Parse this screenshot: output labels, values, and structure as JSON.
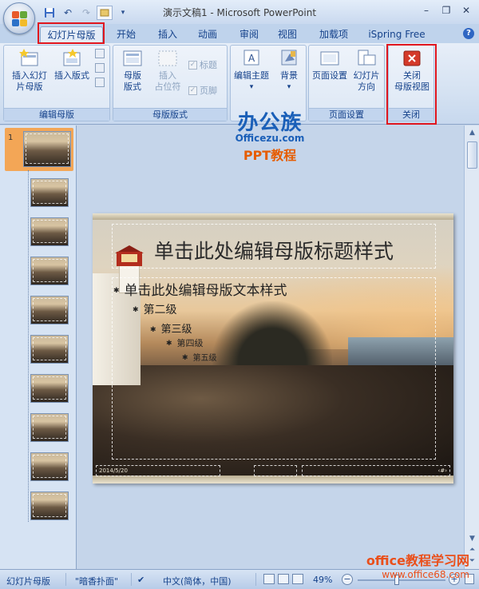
{
  "window": {
    "title": "演示文稿1 - Microsoft PowerPoint",
    "controls": [
      "–",
      "❐",
      "✕"
    ]
  },
  "qat": {
    "icons": [
      "save-icon",
      "undo-icon",
      "redo-icon",
      "customize-icon"
    ]
  },
  "tabs": [
    {
      "label": "幻灯片母版",
      "active": true
    },
    {
      "label": "开始"
    },
    {
      "label": "插入"
    },
    {
      "label": "动画"
    },
    {
      "label": "审阅"
    },
    {
      "label": "视图"
    },
    {
      "label": "加载项"
    },
    {
      "label": "iSpring Free"
    }
  ],
  "help_label": "?",
  "ribbon": {
    "groups": [
      {
        "label": "编辑母版",
        "buttons": [
          "插入幻灯片母版",
          "插入版式"
        ]
      },
      {
        "label": "母版版式",
        "buttons": [
          "母版版式",
          "插入占位符"
        ],
        "checks": [
          "标题",
          "页脚"
        ]
      },
      {
        "label": "",
        "buttons": [
          "编辑主题",
          "背景"
        ]
      },
      {
        "label": "页面设置",
        "buttons": [
          "页面设置",
          "幻灯片方向"
        ]
      },
      {
        "label": "关闭",
        "buttons": [
          "关闭母版视图"
        ]
      }
    ],
    "insert_master_line1": "插入幻灯",
    "insert_master_line2": "片母版",
    "insert_layout": "插入版式",
    "master_layout_line1": "母版",
    "master_layout_line2": "版式",
    "insert_ph_line1": "插入",
    "insert_ph_line2": "占位符",
    "check_title": "标题",
    "check_footer": "页脚",
    "edit_theme": "编辑主题",
    "background": "背景",
    "page_setup": "页面设置",
    "slide_orient_line1": "幻灯片",
    "slide_orient_line2": "方向",
    "close_line1": "关闭",
    "close_line2": "母版视图",
    "group_edit_master": "编辑母版",
    "group_master_layout": "母版版式",
    "group_page_setup": "页面设置",
    "group_close": "关闭"
  },
  "watermark": {
    "brand": "办公族",
    "site": "Officezu.com",
    "sub": "PPT教程"
  },
  "thumbnails": {
    "master_number": "1",
    "count": 10
  },
  "slide": {
    "title": "单击此处编辑母版标题样式",
    "levels": [
      "单击此处编辑母版文本样式",
      "第二级",
      "第三级",
      "第四级",
      "第五级"
    ],
    "footer_date": "2014/5/20",
    "footer_num": "‹#›"
  },
  "status": {
    "view": "幻灯片母版",
    "theme": "\"暗香扑面\"",
    "language": "中文(简体，中国)",
    "zoom": "49%"
  },
  "footer_watermark": {
    "line1": "office教程学习网",
    "line2": "www.office68.com"
  },
  "colors": {
    "accent": "#e0161e",
    "ribbon_text": "#15428b",
    "close_icon": "#d43a2a"
  }
}
